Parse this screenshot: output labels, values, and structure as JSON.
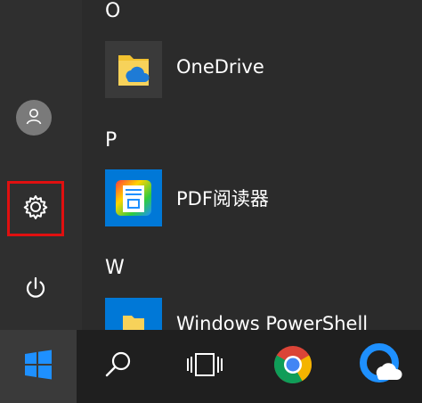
{
  "start_menu": {
    "sections": [
      {
        "letter": "O",
        "apps": [
          {
            "label": "OneDrive",
            "icon": "onedrive-folder-icon"
          }
        ]
      },
      {
        "letter": "P",
        "apps": [
          {
            "label": "PDF阅读器",
            "icon": "pdf-reader-icon"
          }
        ]
      },
      {
        "letter": "W",
        "apps": [
          {
            "label": "Windows PowerShell",
            "icon": "powershell-folder-icon"
          }
        ]
      }
    ]
  },
  "rail": {
    "items": [
      {
        "name": "user-account",
        "icon": "user-icon"
      },
      {
        "name": "settings",
        "icon": "gear-icon",
        "highlighted": true
      },
      {
        "name": "power",
        "icon": "power-icon"
      }
    ]
  },
  "taskbar": {
    "items": [
      {
        "name": "start",
        "icon": "windows-logo-icon"
      },
      {
        "name": "search",
        "icon": "search-icon"
      },
      {
        "name": "task-view",
        "icon": "task-view-icon"
      },
      {
        "name": "chrome",
        "icon": "chrome-icon"
      },
      {
        "name": "cloud-app",
        "icon": "cloud-app-icon"
      }
    ]
  },
  "colors": {
    "highlight_border": "#e01010",
    "tile_blue": "#0078d7",
    "accent_blue": "#1e90ff"
  }
}
